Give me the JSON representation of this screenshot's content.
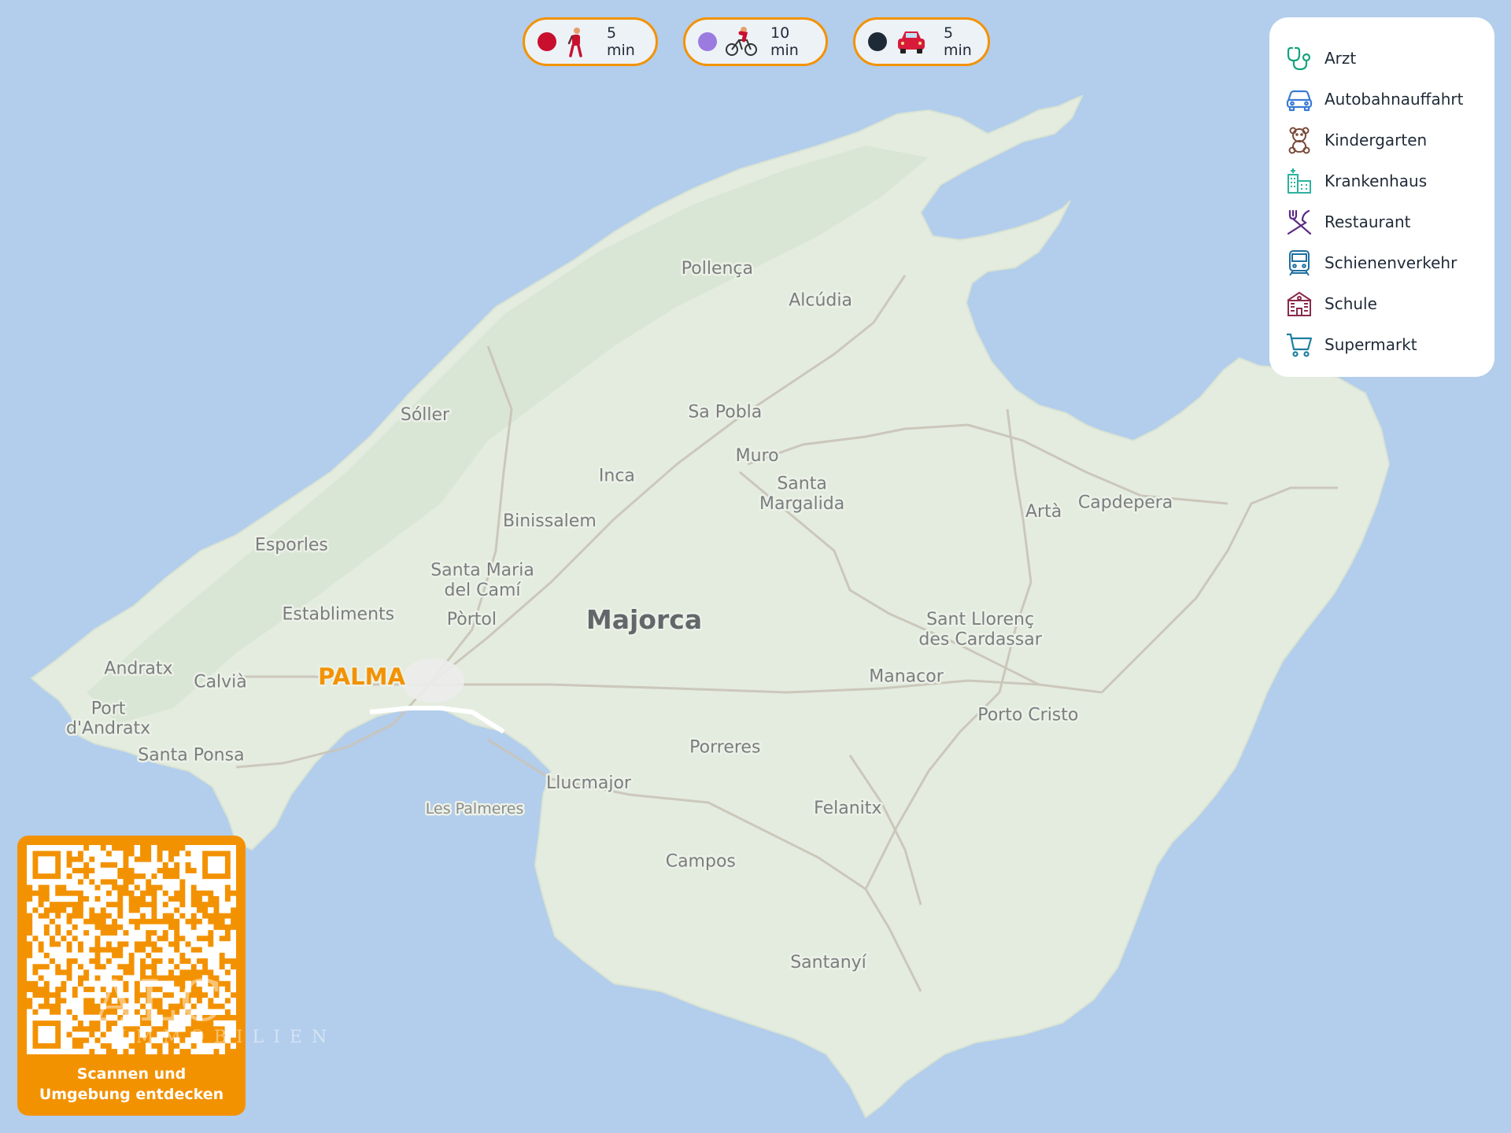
{
  "map": {
    "island": "Majorca",
    "capital": "PALMA",
    "places": [
      {
        "name": "Pollença",
        "lng": 3.015,
        "lat": 39.877
      },
      {
        "name": "Alcúdia",
        "lng": 3.121,
        "lat": 39.853
      },
      {
        "name": "Sóller",
        "lng": 2.715,
        "lat": 39.767
      },
      {
        "name": "Sa Pobla",
        "lng": 3.023,
        "lat": 39.769
      },
      {
        "name": "Muro",
        "lng": 3.056,
        "lat": 39.736
      },
      {
        "name": "Inca",
        "lng": 2.912,
        "lat": 39.721
      },
      {
        "name": "Santa",
        "lng": 3.102,
        "lat": 39.715
      },
      {
        "name": "Margalida",
        "lng": 3.102,
        "lat": 39.7
      },
      {
        "name": "Binissalem",
        "lng": 2.843,
        "lat": 39.687
      },
      {
        "name": "Esporles",
        "lng": 2.578,
        "lat": 39.669
      },
      {
        "name": "Santa Maria",
        "lng": 2.774,
        "lat": 39.65
      },
      {
        "name": "del Camí",
        "lng": 2.774,
        "lat": 39.635
      },
      {
        "name": "Establiments",
        "lng": 2.626,
        "lat": 39.617
      },
      {
        "name": "Pòrtol",
        "lng": 2.763,
        "lat": 39.613
      },
      {
        "name": "Sant Llorenç",
        "lng": 3.285,
        "lat": 39.613
      },
      {
        "name": "des Cardassar",
        "lng": 3.285,
        "lat": 39.598
      },
      {
        "name": "Artà",
        "lng": 3.35,
        "lat": 39.694
      },
      {
        "name": "Capdepera",
        "lng": 3.434,
        "lat": 39.701
      },
      {
        "name": "Andratx",
        "lng": 2.421,
        "lat": 39.576
      },
      {
        "name": "Calvià",
        "lng": 2.505,
        "lat": 39.566
      },
      {
        "name": "Port",
        "lng": 2.39,
        "lat": 39.546
      },
      {
        "name": "d'Andratx",
        "lng": 2.39,
        "lat": 39.531
      },
      {
        "name": "Manacor",
        "lng": 3.209,
        "lat": 39.57
      },
      {
        "name": "Porto Cristo",
        "lng": 3.334,
        "lat": 39.541
      },
      {
        "name": "Santa Ponsa",
        "lng": 2.475,
        "lat": 39.511
      },
      {
        "name": "Porreres",
        "lng": 3.023,
        "lat": 39.517
      },
      {
        "name": "Llucmajor",
        "lng": 2.883,
        "lat": 39.49
      },
      {
        "name": "Felanitx",
        "lng": 3.149,
        "lat": 39.471
      },
      {
        "name": "Campos",
        "lng": 2.998,
        "lat": 39.431
      },
      {
        "name": "Santanyí",
        "lng": 3.129,
        "lat": 39.355
      }
    ],
    "small_places": [
      {
        "name": "Les Palmeres",
        "lng": 2.766,
        "lat": 39.471
      }
    ]
  },
  "travel_modes": [
    {
      "mode": "walk",
      "dot_color": "#c8102e",
      "icon": "walking-person-icon",
      "label": "5 min"
    },
    {
      "mode": "bike",
      "dot_color": "#9b7be0",
      "icon": "cyclist-icon",
      "label": "10 min"
    },
    {
      "mode": "car",
      "dot_color": "#1f2a37",
      "icon": "car-icon",
      "label": "5 min"
    }
  ],
  "legend": {
    "items": [
      {
        "label": "Arzt",
        "icon": "stethoscope-icon",
        "color": "#16a37f"
      },
      {
        "label": "Autobahnauffahrt",
        "icon": "car-outline-icon",
        "color": "#3a7bd5"
      },
      {
        "label": "Kindergarten",
        "icon": "teddy-bear-icon",
        "color": "#7a4a3a"
      },
      {
        "label": "Krankenhaus",
        "icon": "hospital-icon",
        "color": "#2db39e"
      },
      {
        "label": "Restaurant",
        "icon": "fork-knife-icon",
        "color": "#5b2a86"
      },
      {
        "label": "Schienenverkehr",
        "icon": "train-icon",
        "color": "#1e6fa0"
      },
      {
        "label": "Schule",
        "icon": "school-building-icon",
        "color": "#8a2a4a"
      },
      {
        "label": "Supermarkt",
        "icon": "shopping-cart-icon",
        "color": "#1e7fa0"
      }
    ]
  },
  "qr": {
    "caption_line1": "Scannen und",
    "caption_line2": "Umgebung entdecken"
  },
  "watermark": {
    "main": "ALC",
    "sub": "IMMOBILIEN"
  },
  "colors": {
    "sea": "#b3cdec",
    "land": "#e4ecdf",
    "accent": "#f39200"
  }
}
